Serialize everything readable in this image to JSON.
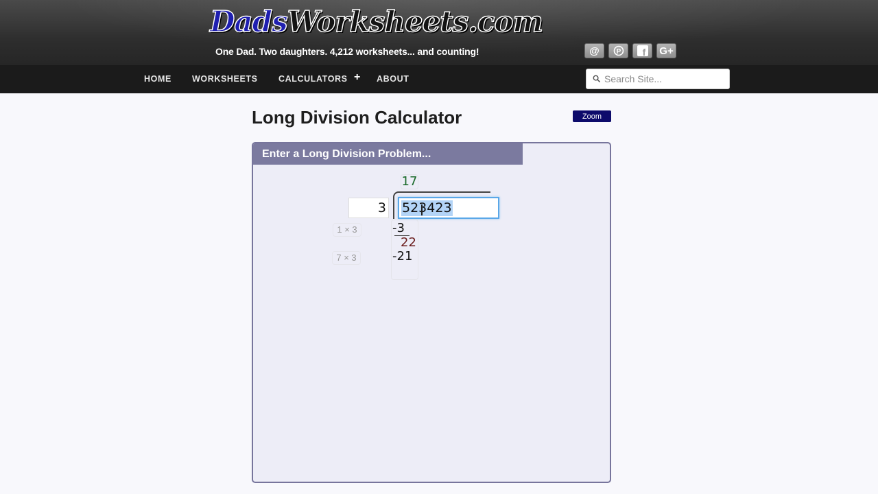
{
  "header": {
    "logo_part1": "Dads",
    "logo_part2": "Worksheets.com",
    "tagline": "One Dad. Two daughters. 4,212 worksheets... and counting!",
    "social": [
      "@",
      "P",
      "f",
      "G+"
    ]
  },
  "nav": {
    "items": [
      "HOME",
      "WORKSHEETS",
      "CALCULATORS",
      "ABOUT"
    ],
    "expand_symbol": "+",
    "search_placeholder": "Search Site..."
  },
  "page": {
    "title": "Long Division Calculator",
    "zoom_label": "Zoom"
  },
  "calculator": {
    "panel_title": "Enter a Long Division Problem...",
    "divisor": "3",
    "dividend": "523423",
    "quotient": "17",
    "steps": [
      {
        "text": "-3",
        "hint": "1 × 3"
      },
      {
        "text": "22",
        "hint": ""
      },
      {
        "text": "-21",
        "hint": "7 × 3"
      }
    ]
  },
  "colors": {
    "header_bg": "#333333",
    "nav_bg": "#1b1b1b",
    "panel_header": "#7b7a9f",
    "zoom_button": "#0d0b6b",
    "quotient_text": "#1a6a2a",
    "selection": "#b3d4f7"
  }
}
